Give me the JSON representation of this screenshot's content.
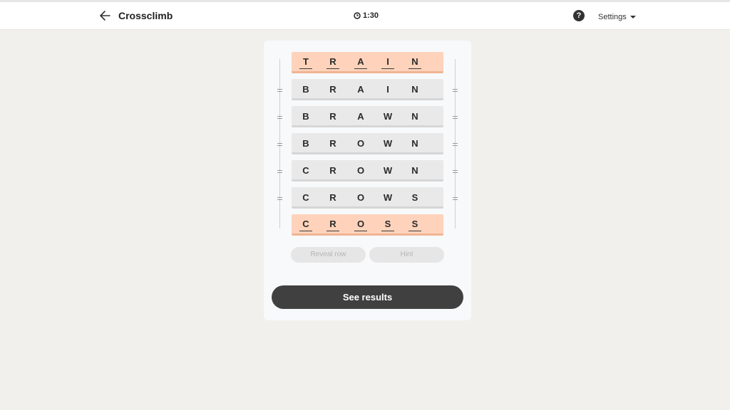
{
  "header": {
    "title": "Crossclimb",
    "timer": "1:30",
    "help": "?",
    "settings_label": "Settings"
  },
  "puzzle": {
    "rows": [
      {
        "letters": [
          "T",
          "R",
          "A",
          "I",
          "N"
        ],
        "locked": true
      },
      {
        "letters": [
          "B",
          "R",
          "A",
          "I",
          "N"
        ],
        "locked": false
      },
      {
        "letters": [
          "B",
          "R",
          "A",
          "W",
          "N"
        ],
        "locked": false
      },
      {
        "letters": [
          "B",
          "R",
          "O",
          "W",
          "N"
        ],
        "locked": false
      },
      {
        "letters": [
          "C",
          "R",
          "O",
          "W",
          "N"
        ],
        "locked": false
      },
      {
        "letters": [
          "C",
          "R",
          "O",
          "W",
          "S"
        ],
        "locked": false
      },
      {
        "letters": [
          "C",
          "R",
          "O",
          "S",
          "S"
        ],
        "locked": true
      }
    ]
  },
  "controls": {
    "reveal_row_label": "Reveal row",
    "hint_label": "Hint",
    "see_results_label": "See results"
  },
  "colors": {
    "locked_row": "#ffd3bb",
    "normal_row": "#e9e9e9",
    "primary_button": "#404040",
    "background": "#f2f0ec"
  }
}
